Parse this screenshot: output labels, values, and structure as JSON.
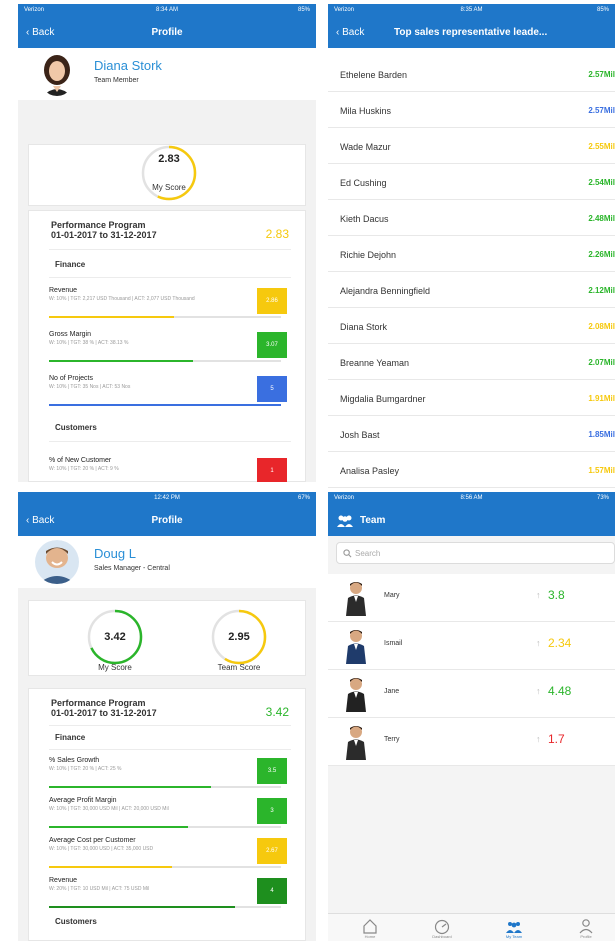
{
  "colors": {
    "primary": "#1f77c9",
    "green": "#2bb52b",
    "yellow": "#f6c90e",
    "blue": "#3a6fe0",
    "red": "#e8262a",
    "darkgreen": "#1e8f1e"
  },
  "screen1": {
    "status": {
      "carrier": "Verizon",
      "time": "8:34 AM",
      "battery": "85%"
    },
    "nav": {
      "back": "Back",
      "title": "Profile"
    },
    "profile": {
      "name": "Diana Stork",
      "role": "Team Member"
    },
    "score": {
      "value": "2.83",
      "label": "My Score",
      "fraction": 0.57,
      "color": "#f6c90e"
    },
    "performance": {
      "title": "Performance Program",
      "dates": "01-01-2017 to 31-12-2017",
      "score": "2.83"
    },
    "finance_label": "Finance",
    "finance": [
      {
        "name": "Revenue",
        "detail": "W: 10% | TGT: 2,217 USD Thousand | ACT: 2,077 USD Thousand",
        "value": "2.86",
        "color": "#f6c90e",
        "progress": 0.54
      },
      {
        "name": "Gross Margin",
        "detail": "W: 10% | TGT: 38 % | ACT: 38.13 %",
        "value": "3.07",
        "color": "#2bb52b",
        "progress": 0.62
      },
      {
        "name": "No of Projects",
        "detail": "W: 10% | TGT: 35 Nos | ACT: 53 Nos",
        "value": "5",
        "color": "#3a6fe0",
        "progress": 1.0
      }
    ],
    "customers_label": "Customers",
    "customers": [
      {
        "name": "% of New Customer",
        "detail": "W: 10% | TGT: 20 % | ACT: 9 %",
        "value": "1",
        "color": "#e8262a",
        "progress": 0.19
      }
    ]
  },
  "screen2": {
    "status": {
      "carrier": "Verizon",
      "time": "8:35 AM",
      "battery": "85%"
    },
    "nav": {
      "back": "Back",
      "title": "Top sales representative leade..."
    },
    "leaders": [
      {
        "name": "Ethelene Barden",
        "value": "2.57Mil",
        "color": "#2bb52b"
      },
      {
        "name": "Mila Huskins",
        "value": "2.57Mil",
        "color": "#3a6fe0"
      },
      {
        "name": "Wade Mazur",
        "value": "2.55Mil",
        "color": "#f6c90e"
      },
      {
        "name": "Ed Cushing",
        "value": "2.54Mil",
        "color": "#2bb52b"
      },
      {
        "name": "Kieth Dacus",
        "value": "2.48Mil",
        "color": "#2bb52b"
      },
      {
        "name": "Richie Dejohn",
        "value": "2.26Mil",
        "color": "#2bb52b"
      },
      {
        "name": "Alejandra Benningfield",
        "value": "2.12Mil",
        "color": "#2bb52b"
      },
      {
        "name": "Diana Stork",
        "value": "2.08Mil",
        "color": "#f6c90e"
      },
      {
        "name": "Breanne Yeaman",
        "value": "2.07Mil",
        "color": "#2bb52b"
      },
      {
        "name": "Migdalia Bumgardner",
        "value": "1.91Mil",
        "color": "#f6c90e"
      },
      {
        "name": "Josh Bast",
        "value": "1.85Mil",
        "color": "#3a6fe0"
      },
      {
        "name": "Analisa Pasley",
        "value": "1.57Mil",
        "color": "#f6c90e"
      }
    ]
  },
  "screen3": {
    "status": {
      "carrier": "",
      "time": "12:42 PM",
      "battery": "67%"
    },
    "nav": {
      "back": "Back",
      "title": "Profile"
    },
    "profile": {
      "name": "Doug L",
      "role": "Sales Manager - Central"
    },
    "my_score": {
      "value": "3.42",
      "label": "My Score",
      "fraction": 0.68,
      "color": "#2bb52b"
    },
    "team_score": {
      "value": "2.95",
      "label": "Team Score",
      "fraction": 0.59,
      "color": "#f6c90e"
    },
    "performance": {
      "title": "Performance Program",
      "dates": "01-01-2017 to 31-12-2017",
      "score": "3.42"
    },
    "finance_label": "Finance",
    "finance": [
      {
        "name": "% Sales Growth",
        "detail": "W: 10% | TGT: 20 % | ACT: 25 %",
        "value": "3.5",
        "color": "#2bb52b",
        "progress": 0.7
      },
      {
        "name": "Average Profit Margin",
        "detail": "W: 10% | TGT: 30,000 USD Mil | ACT: 20,000 USD Mil",
        "value": "3",
        "color": "#2bb52b",
        "progress": 0.6
      },
      {
        "name": "Average Cost per Customer",
        "detail": "W: 10% | TGT: 30,000 USD | ACT: 35,000 USD",
        "value": "2.67",
        "color": "#f6c90e",
        "progress": 0.53
      },
      {
        "name": "Revenue",
        "detail": "W: 20% | TGT: 10 USD Mil | ACT: 75 USD Mil",
        "value": "4",
        "color": "#1e8f1e",
        "progress": 0.8
      }
    ],
    "customers_label": "Customers"
  },
  "screen4": {
    "status": {
      "carrier": "Verizon",
      "time": "8:56 AM",
      "battery": "73%"
    },
    "nav": {
      "title": "Team"
    },
    "search": {
      "placeholder": "Search",
      "value": ""
    },
    "members": [
      {
        "name": "Mary",
        "trend": "↑",
        "score": "3.8",
        "color": "#2bb52b"
      },
      {
        "name": "Ismail",
        "trend": "↑",
        "score": "2.34",
        "color": "#f6c90e"
      },
      {
        "name": "Jane",
        "trend": "↑",
        "score": "4.48",
        "color": "#2bb52b"
      },
      {
        "name": "Terry",
        "trend": "↑",
        "score": "1.7",
        "color": "#e8262a"
      }
    ],
    "tabs": [
      {
        "label": "Home",
        "icon": "home-icon"
      },
      {
        "label": "Dashboard",
        "icon": "dashboard-icon"
      },
      {
        "label": "My Team",
        "icon": "team-icon",
        "active": true
      },
      {
        "label": "Profile",
        "icon": "profile-icon"
      }
    ]
  }
}
